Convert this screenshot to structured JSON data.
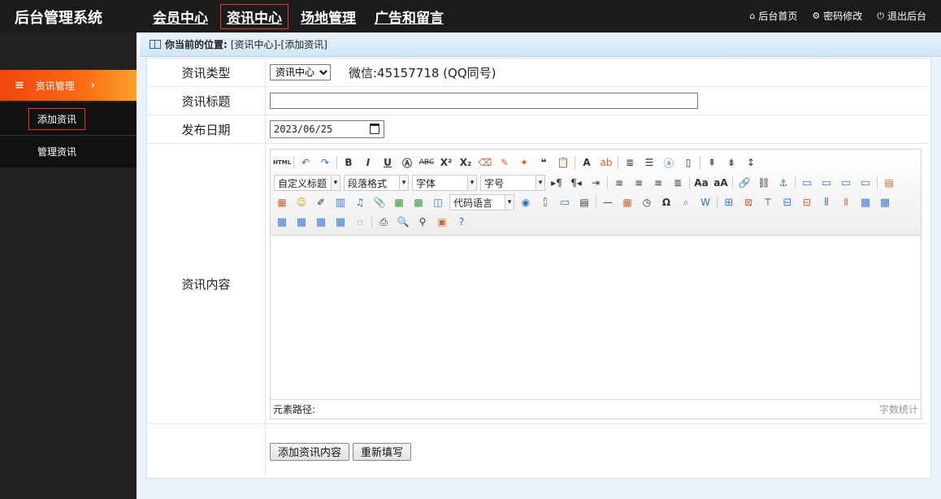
{
  "app": {
    "title": "后台管理系统"
  },
  "topnav": [
    {
      "label": "会员中心",
      "active": false
    },
    {
      "label": "资讯中心",
      "active": true
    },
    {
      "label": "场地管理",
      "active": false
    },
    {
      "label": "广告和留言",
      "active": false
    }
  ],
  "toplinks": [
    {
      "label": "后台首页",
      "icon": "home-icon"
    },
    {
      "label": "密码修改",
      "icon": "gear-icon"
    },
    {
      "label": "退出后台",
      "icon": "power-icon"
    }
  ],
  "sidebar": {
    "section": "资讯管理",
    "items": [
      {
        "label": "添加资讯",
        "active": true
      },
      {
        "label": "管理资讯",
        "active": false
      }
    ]
  },
  "breadcrumb": {
    "prefix": "你当前的位置:",
    "path": "[资讯中心]-[添加资讯]"
  },
  "form": {
    "category": {
      "label": "资讯类型",
      "selected": "资讯中心",
      "note": "微信:45157718 (QQ同号)"
    },
    "title": {
      "label": "资讯标题",
      "value": ""
    },
    "date": {
      "label": "发布日期",
      "value": "2023/06/25"
    },
    "content": {
      "label": "资讯内容"
    },
    "submit_label": "添加资讯内容",
    "reset_label": "重新填写"
  },
  "editor": {
    "dropdowns": {
      "custom_title": "自定义标题",
      "paragraph": "段落格式",
      "font": "字体",
      "size": "字号",
      "code": "代码语言"
    },
    "path_label": "元素路径:",
    "word_count_label": "字数统计"
  }
}
